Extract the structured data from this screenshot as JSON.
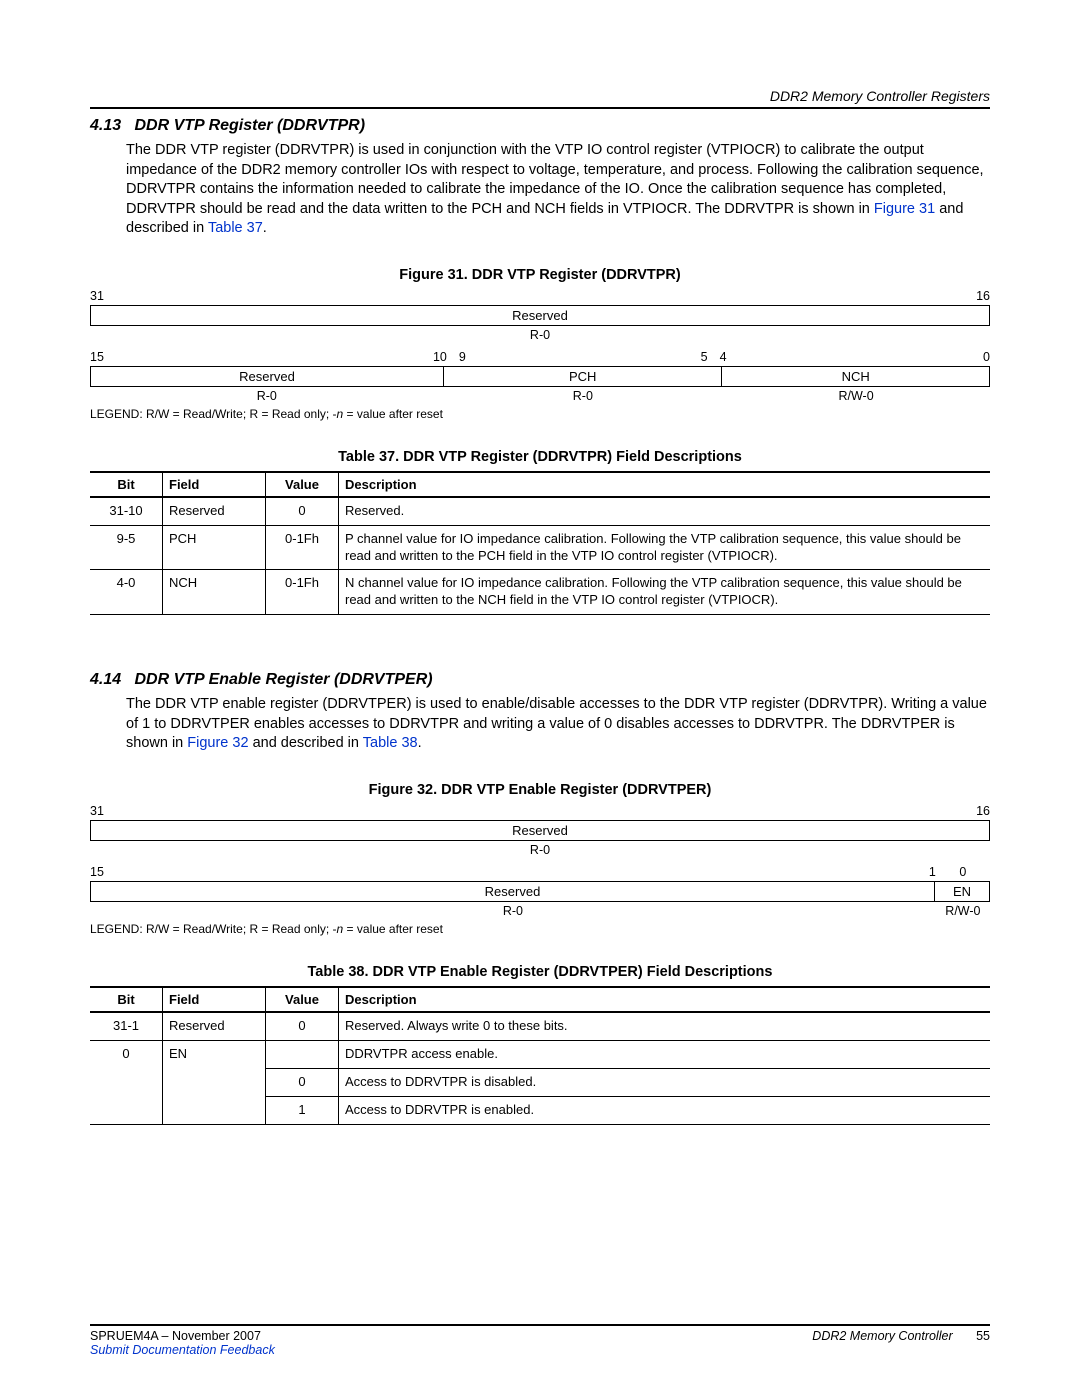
{
  "header": {
    "context": "DDR2 Memory Controller Registers"
  },
  "section413": {
    "num": "4.13",
    "title": "DDR VTP Register (DDRVTPR)",
    "para_pre": "The DDR VTP register (DDRVTPR) is used in conjunction with the VTP IO control register (VTPIOCR) to calibrate the output impedance of the DDR2 memory controller IOs with respect to voltage, temperature, and process. Following the calibration sequence, DDRVTPR contains the information needed to calibrate the impedance of the IO. Once the calibration sequence has completed, DDRVTPR should be read and the data written to the PCH and NCH fields in VTPIOCR. The DDRVTPR is shown in ",
    "link1": "Figure 31",
    "mid": " and described in ",
    "link2": "Table 37",
    "tail": "."
  },
  "fig31": {
    "caption": "Figure 31. DDR VTP Register (DDRVTPR)",
    "row1_left": "31",
    "row1_right": "16",
    "row1_field": "Reserved",
    "row1_rw": "R-0",
    "row2_b15": "15",
    "row2_b10": "10",
    "row2_b9": "9",
    "row2_b5": "5",
    "row2_b4": "4",
    "row2_b0": "0",
    "row2_f1": "Reserved",
    "row2_f2": "PCH",
    "row2_f3": "NCH",
    "row2_rw1": "R-0",
    "row2_rw2": "R-0",
    "row2_rw3": "R/W-0",
    "legend_pre": "LEGEND: R/W = Read/Write; R = Read only; -",
    "legend_n": "n",
    "legend_post": " = value after reset"
  },
  "table37": {
    "caption": "Table 37. DDR VTP Register (DDRVTPR) Field Descriptions",
    "headers": {
      "bit": "Bit",
      "field": "Field",
      "value": "Value",
      "desc": "Description"
    },
    "rows": [
      {
        "bit": "31-10",
        "field": "Reserved",
        "value": "0",
        "desc": "Reserved."
      },
      {
        "bit": "9-5",
        "field": "PCH",
        "value": "0-1Fh",
        "desc": "P channel value for IO impedance calibration. Following the VTP calibration sequence, this value should be read and written to the PCH field in the VTP IO control register (VTPIOCR)."
      },
      {
        "bit": "4-0",
        "field": "NCH",
        "value": "0-1Fh",
        "desc": "N channel value for IO impedance calibration. Following the VTP calibration sequence, this value should be read and written to the NCH field in the VTP IO control register (VTPIOCR)."
      }
    ]
  },
  "section414": {
    "num": "4.14",
    "title": "DDR VTP Enable Register (DDRVTPER)",
    "para_pre": "The DDR VTP enable register (DDRVTPER) is used to enable/disable accesses to the DDR VTP register (DDRVTPR). Writing a value of 1 to DDRVTPER enables accesses to DDRVTPR and writing a value of 0 disables accesses to DDRVTPR. The DDRVTPER is shown in ",
    "link1": "Figure 32",
    "mid": " and described in ",
    "link2": "Table 38",
    "tail": "."
  },
  "fig32": {
    "caption": "Figure 32. DDR VTP Enable Register (DDRVTPER)",
    "row1_left": "31",
    "row1_right": "16",
    "row1_field": "Reserved",
    "row1_rw": "R-0",
    "row2_b15": "15",
    "row2_b1": "1",
    "row2_b0": "0",
    "row2_f1": "Reserved",
    "row2_f2": "EN",
    "row2_rw1": "R-0",
    "row2_rw2": "R/W-0",
    "legend_pre": "LEGEND: R/W = Read/Write; R = Read only; -",
    "legend_n": "n",
    "legend_post": " = value after reset"
  },
  "table38": {
    "caption": "Table 38. DDR VTP Enable Register (DDRVTPER) Field Descriptions",
    "headers": {
      "bit": "Bit",
      "field": "Field",
      "value": "Value",
      "desc": "Description"
    },
    "rows": [
      {
        "bit": "31-1",
        "field": "Reserved",
        "value": "0",
        "desc": "Reserved. Always write 0 to these bits."
      },
      {
        "bit": "0",
        "field": "EN",
        "value": "",
        "desc": "DDRVTPR access enable."
      },
      {
        "bit": "",
        "field": "",
        "value": "0",
        "desc": "Access to DDRVTPR is disabled."
      },
      {
        "bit": "",
        "field": "",
        "value": "1",
        "desc": "Access to DDRVTPR is enabled."
      }
    ]
  },
  "footer": {
    "left": "SPRUEM4A – November 2007",
    "right_title": "DDR2 Memory Controller",
    "page_num": "55",
    "feedback": "Submit Documentation Feedback"
  }
}
